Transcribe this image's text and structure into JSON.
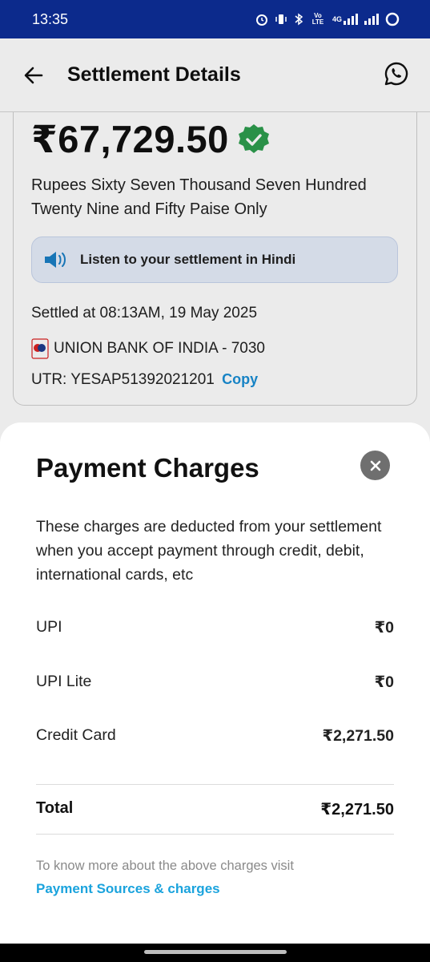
{
  "status_bar": {
    "time": "13:35",
    "network_label": "4G",
    "volte_label": "Vo LTE"
  },
  "header": {
    "title": "Settlement Details",
    "back_icon": "arrow-left-icon",
    "support_icon": "whatsapp-icon"
  },
  "settlement": {
    "amount": "₹67,729.50",
    "amount_words": "Rupees Sixty Seven Thousand Seven Hundred Twenty Nine and Fifty Paise Only",
    "listen_label": "Listen to your settlement in Hindi",
    "settled_at": "Settled at 08:13AM, 19 May 2025",
    "bank": "UNION BANK OF INDIA - 7030",
    "utr": "UTR: YESAP51392021201",
    "copy_label": "Copy"
  },
  "sheet": {
    "title": "Payment Charges",
    "description": "These charges are deducted from your settlement when you accept payment through credit, debit, international cards, etc",
    "charges": [
      {
        "label": "UPI",
        "value": "₹0"
      },
      {
        "label": "UPI Lite",
        "value": "₹0"
      },
      {
        "label": "Credit Card",
        "value": "₹2,271.50"
      }
    ],
    "total": {
      "label": "Total",
      "value": "₹2,271.50"
    },
    "more_info": "To know more about the above charges visit",
    "link_label": "Payment Sources & charges"
  },
  "colors": {
    "status_bar": "#0c2a8c",
    "accent_link": "#1aa3dd",
    "verified_green": "#2e9e4f"
  }
}
